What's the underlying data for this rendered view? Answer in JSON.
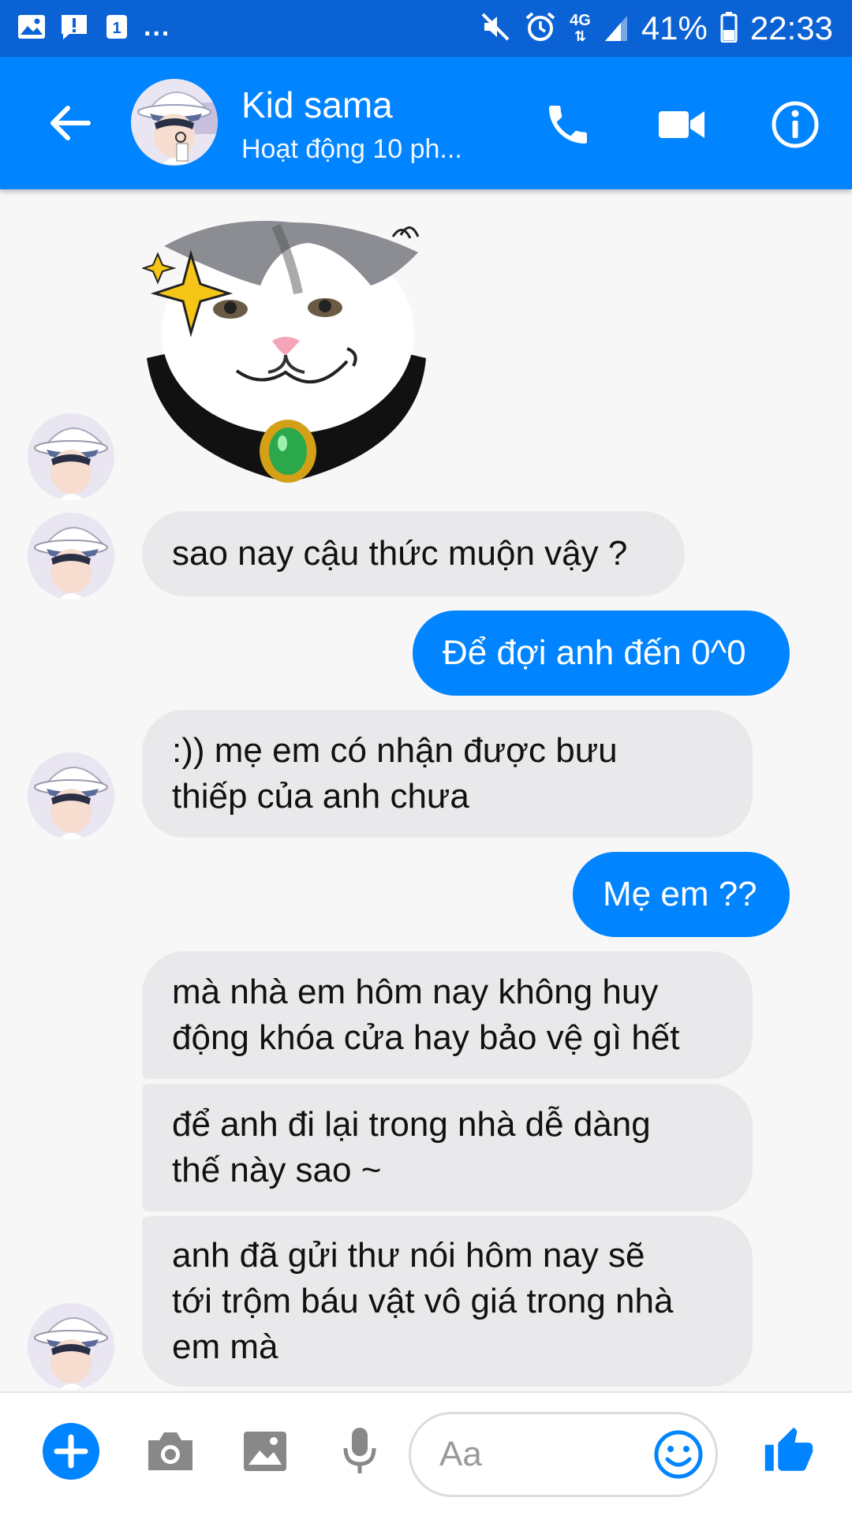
{
  "status_bar": {
    "notification_icons": [
      "gallery-icon",
      "alert-icon",
      "one-icon"
    ],
    "more": "...",
    "network": "4G",
    "battery": "41%",
    "time": "22:33"
  },
  "header": {
    "contact_name": "Kid sama",
    "activity": "Hoạt động 10 ph...",
    "accent": "#0084ff"
  },
  "messages": [
    {
      "id": 1,
      "direction": "in",
      "lines": [
        "sao nay cậu thức muộn vậy ?"
      ]
    },
    {
      "id": 2,
      "direction": "out",
      "lines": [
        "Để đợi anh đến 0^0"
      ]
    },
    {
      "id": 3,
      "direction": "in",
      "lines": [
        ":)) mẹ em có nhận được bưu",
        "thiếp của anh chưa"
      ]
    },
    {
      "id": 4,
      "direction": "out",
      "lines": [
        "Mẹ em ??"
      ]
    },
    {
      "id": 5,
      "direction": "in",
      "lines": [
        "mà nhà em hôm nay không huy",
        "động khóa cửa hay bảo vệ gì hết"
      ]
    },
    {
      "id": 6,
      "direction": "in",
      "lines": [
        "để anh đi lại trong nhà dễ dàng",
        "thế này sao ~"
      ]
    },
    {
      "id": 7,
      "direction": "in",
      "lines": [
        "anh đã gửi thư nói hôm nay sẽ",
        "tới trộm báu vật vô giá trong nhà",
        "em mà"
      ]
    }
  ],
  "composer": {
    "placeholder": "Aa"
  }
}
